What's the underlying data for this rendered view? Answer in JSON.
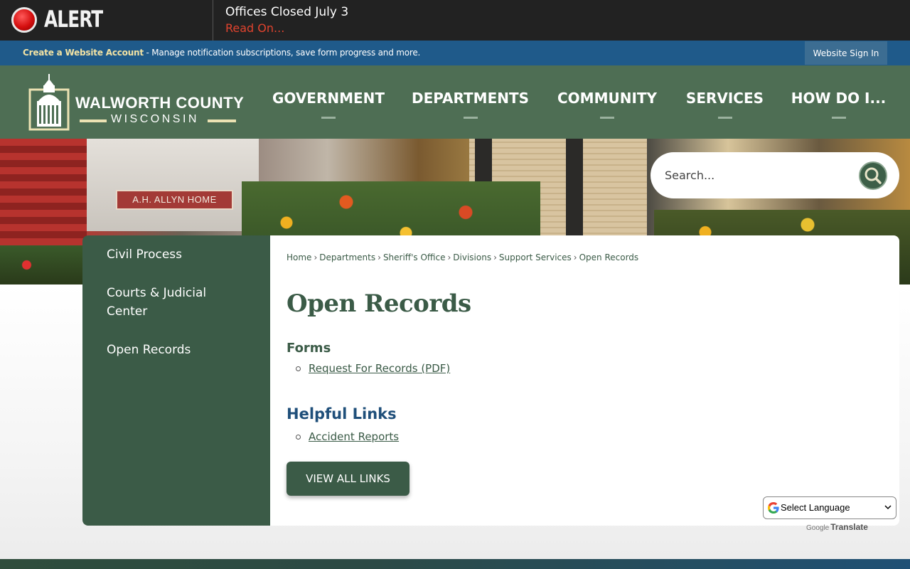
{
  "alert": {
    "label": "ALERT",
    "title": "Offices Closed July 3",
    "link": "Read On..."
  },
  "account_bar": {
    "create_link": "Create a Website Account",
    "description": " - Manage notification subscriptions, save form progress and more.",
    "sign_in": "Website Sign In"
  },
  "logo": {
    "name": "WALWORTH COUNTY",
    "subtitle": "WISCONSIN"
  },
  "nav": {
    "items": [
      {
        "label": "GOVERNMENT"
      },
      {
        "label": "DEPARTMENTS"
      },
      {
        "label": "COMMUNITY"
      },
      {
        "label": "SERVICES"
      },
      {
        "label": "HOW DO I..."
      }
    ]
  },
  "hero": {
    "sign_text": "A.H. ALLYN HOME"
  },
  "search": {
    "placeholder": "Search..."
  },
  "sidebar": {
    "items": [
      {
        "label": "Civil Process"
      },
      {
        "label": "Courts & Judicial Center"
      },
      {
        "label": "Open Records"
      }
    ]
  },
  "breadcrumb": {
    "items": [
      "Home",
      "Departments",
      "Sheriff's Office",
      "Divisions",
      "Support Services",
      "Open Records"
    ],
    "separator": "›"
  },
  "page": {
    "title": "Open Records",
    "forms_heading": "Forms",
    "forms_links": [
      "Request For Records (PDF)"
    ],
    "helpful_heading": "Helpful Links",
    "helpful_links": [
      "Accident Reports"
    ],
    "view_all_button": "VIEW ALL LINKS"
  },
  "translate": {
    "select_label": "Select Language",
    "powered_google": "Google",
    "powered_translate": "Translate"
  },
  "colors": {
    "primary_green": "#3b5b47",
    "header_green": "#4e6e54",
    "account_blue": "#1f5a8a",
    "alert_red": "#e0432e",
    "heading_blue": "#1f4f7a"
  },
  "icons": [
    "alert-dot-icon",
    "search-icon",
    "google-g-icon",
    "chevron-down-icon",
    "courthouse-logo-icon"
  ]
}
